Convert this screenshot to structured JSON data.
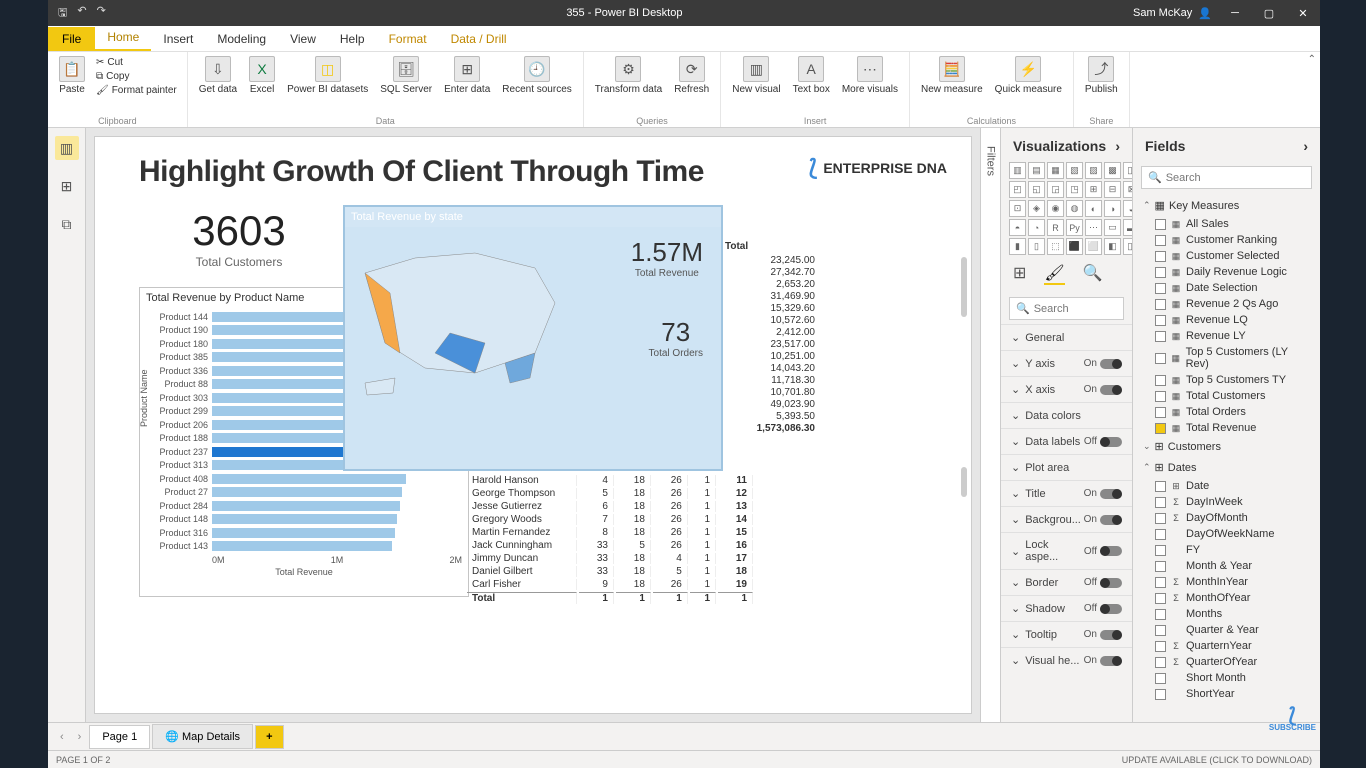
{
  "titlebar": {
    "title": "355 - Power BI Desktop",
    "user": "Sam McKay"
  },
  "ribbon_tabs": {
    "file": "File",
    "tabs": [
      "Home",
      "Insert",
      "Modeling",
      "View",
      "Help",
      "Format",
      "Data / Drill"
    ],
    "active": "Home"
  },
  "ribbon_groups": {
    "clipboard": {
      "label": "Clipboard",
      "paste": "Paste",
      "cut": "Cut",
      "copy": "Copy",
      "format_painter": "Format painter"
    },
    "data": {
      "label": "Data",
      "get_data": "Get\ndata",
      "excel": "Excel",
      "pbi_ds": "Power BI\ndatasets",
      "sql": "SQL\nServer",
      "enter": "Enter\ndata",
      "recent": "Recent\nsources"
    },
    "queries": {
      "label": "Queries",
      "transform": "Transform\ndata",
      "refresh": "Refresh"
    },
    "insert": {
      "label": "Insert",
      "new_visual": "New\nvisual",
      "text_box": "Text\nbox",
      "more": "More\nvisuals"
    },
    "calc": {
      "label": "Calculations",
      "new_measure": "New\nmeasure",
      "quick": "Quick\nmeasure"
    },
    "share": {
      "label": "Share",
      "publish": "Publish"
    }
  },
  "report": {
    "title": "Highlight Growth Of Client Through Time",
    "logo": "ENTERPRISE DNA"
  },
  "card_customers": {
    "value": "3603",
    "label": "Total Customers"
  },
  "map": {
    "title": "Total Revenue by state",
    "kpi1_value": "1.57M",
    "kpi1_label": "Total Revenue",
    "kpi2_value": "73",
    "kpi2_label": "Total Orders"
  },
  "totals_col": {
    "header": "Total",
    "values": [
      "23,245.00",
      "27,342.70",
      "2,653.20",
      "31,469.90",
      "15,329.60",
      "10,572.60",
      "2,412.00",
      "23,517.00",
      "10,251.00",
      "14,043.20",
      "11,718.30",
      "10,701.80",
      "49,023.90",
      "5,393.50"
    ],
    "grand": "1,573,086.30"
  },
  "chart_data": {
    "type": "bar",
    "title": "Total Revenue by Product Name",
    "xlabel": "Total Revenue",
    "ylabel": "Product Name",
    "xlim_labels": [
      "0M",
      "1M",
      "2M"
    ],
    "selected": "Product 237",
    "series": [
      {
        "name": "Product 144",
        "value": 1.95
      },
      {
        "name": "Product 190",
        "value": 1.9
      },
      {
        "name": "Product 180",
        "value": 1.88
      },
      {
        "name": "Product 385",
        "value": 1.82
      },
      {
        "name": "Product 336",
        "value": 1.8
      },
      {
        "name": "Product 88",
        "value": 1.78
      },
      {
        "name": "Product 303",
        "value": 1.75
      },
      {
        "name": "Product 299",
        "value": 1.72
      },
      {
        "name": "Product 206",
        "value": 1.7
      },
      {
        "name": "Product 188",
        "value": 1.68
      },
      {
        "name": "Product 237",
        "value": 1.67
      },
      {
        "name": "Product 313",
        "value": 1.6
      },
      {
        "name": "Product 408",
        "value": 1.55
      },
      {
        "name": "Product 27",
        "value": 1.52
      },
      {
        "name": "Product 284",
        "value": 1.5
      },
      {
        "name": "Product 148",
        "value": 1.48
      },
      {
        "name": "Product 316",
        "value": 1.46
      },
      {
        "name": "Product 143",
        "value": 1.44
      }
    ]
  },
  "table": {
    "rows": [
      {
        "name": "Harold Hanson",
        "c1": "4",
        "c2": "18",
        "c3": "26",
        "c4": "1",
        "c5": "11"
      },
      {
        "name": "George Thompson",
        "c1": "5",
        "c2": "18",
        "c3": "26",
        "c4": "1",
        "c5": "12"
      },
      {
        "name": "Jesse Gutierrez",
        "c1": "6",
        "c2": "18",
        "c3": "26",
        "c4": "1",
        "c5": "13"
      },
      {
        "name": "Gregory Woods",
        "c1": "7",
        "c2": "18",
        "c3": "26",
        "c4": "1",
        "c5": "14"
      },
      {
        "name": "Martin Fernandez",
        "c1": "8",
        "c2": "18",
        "c3": "26",
        "c4": "1",
        "c5": "15"
      },
      {
        "name": "Jack Cunningham",
        "c1": "33",
        "c2": "5",
        "c3": "26",
        "c4": "1",
        "c5": "16"
      },
      {
        "name": "Jimmy Duncan",
        "c1": "33",
        "c2": "18",
        "c3": "4",
        "c4": "1",
        "c5": "17"
      },
      {
        "name": "Daniel Gilbert",
        "c1": "33",
        "c2": "18",
        "c3": "5",
        "c4": "1",
        "c5": "18"
      },
      {
        "name": "Carl Fisher",
        "c1": "9",
        "c2": "18",
        "c3": "26",
        "c4": "1",
        "c5": "19"
      }
    ],
    "total_label": "Total",
    "total": {
      "c1": "1",
      "c2": "1",
      "c3": "1",
      "c4": "1",
      "c5": "1"
    }
  },
  "filters_label": "Filters",
  "viz_pane": {
    "title": "Visualizations",
    "search": "Search",
    "sections": [
      {
        "name": "General",
        "toggle": null
      },
      {
        "name": "Y axis",
        "toggle": "On"
      },
      {
        "name": "X axis",
        "toggle": "On"
      },
      {
        "name": "Data colors",
        "toggle": null
      },
      {
        "name": "Data labels",
        "toggle": "Off"
      },
      {
        "name": "Plot area",
        "toggle": null
      },
      {
        "name": "Title",
        "toggle": "On"
      },
      {
        "name": "Backgrou...",
        "toggle": "On"
      },
      {
        "name": "Lock aspe...",
        "toggle": "Off"
      },
      {
        "name": "Border",
        "toggle": "Off"
      },
      {
        "name": "Shadow",
        "toggle": "Off"
      },
      {
        "name": "Tooltip",
        "toggle": "On"
      },
      {
        "name": "Visual he...",
        "toggle": "On"
      }
    ]
  },
  "fields_pane": {
    "title": "Fields",
    "search": "Search",
    "groups": [
      {
        "name": "Key Measures",
        "icon": "▦",
        "expanded": true,
        "items": [
          {
            "name": "All Sales",
            "icon": "▦",
            "checked": false
          },
          {
            "name": "Customer Ranking",
            "icon": "▦",
            "checked": false
          },
          {
            "name": "Customer Selected",
            "icon": "▦",
            "checked": false
          },
          {
            "name": "Daily Revenue Logic",
            "icon": "▦",
            "checked": false
          },
          {
            "name": "Date Selection",
            "icon": "▦",
            "checked": false
          },
          {
            "name": "Revenue 2 Qs Ago",
            "icon": "▦",
            "checked": false
          },
          {
            "name": "Revenue LQ",
            "icon": "▦",
            "checked": false
          },
          {
            "name": "Revenue LY",
            "icon": "▦",
            "checked": false
          },
          {
            "name": "Top 5 Customers (LY Rev)",
            "icon": "▦",
            "checked": false
          },
          {
            "name": "Top 5 Customers TY",
            "icon": "▦",
            "checked": false
          },
          {
            "name": "Total Customers",
            "icon": "▦",
            "checked": false
          },
          {
            "name": "Total Orders",
            "icon": "▦",
            "checked": false
          },
          {
            "name": "Total Revenue",
            "icon": "▦",
            "checked": true
          }
        ]
      },
      {
        "name": "Customers",
        "icon": "⊞",
        "expanded": false,
        "items": []
      },
      {
        "name": "Dates",
        "icon": "⊞",
        "expanded": true,
        "items": [
          {
            "name": "Date",
            "icon": "⊞",
            "checked": false,
            "caret": true
          },
          {
            "name": "DayInWeek",
            "icon": "Σ",
            "checked": false
          },
          {
            "name": "DayOfMonth",
            "icon": "Σ",
            "checked": false
          },
          {
            "name": "DayOfWeekName",
            "icon": "",
            "checked": false
          },
          {
            "name": "FY",
            "icon": "",
            "checked": false
          },
          {
            "name": "Month & Year",
            "icon": "",
            "checked": false
          },
          {
            "name": "MonthInYear",
            "icon": "Σ",
            "checked": false
          },
          {
            "name": "MonthOfYear",
            "icon": "Σ",
            "checked": false
          },
          {
            "name": "Months",
            "icon": "",
            "checked": false
          },
          {
            "name": "Quarter & Year",
            "icon": "",
            "checked": false
          },
          {
            "name": "QuarternYear",
            "icon": "Σ",
            "checked": false
          },
          {
            "name": "QuarterOfYear",
            "icon": "Σ",
            "checked": false
          },
          {
            "name": "Short Month",
            "icon": "",
            "checked": false
          },
          {
            "name": "ShortYear",
            "icon": "",
            "checked": false
          }
        ]
      }
    ]
  },
  "page_tabs": {
    "tabs": [
      "Page 1",
      "Map Details"
    ],
    "active": "Page 1",
    "add": "+"
  },
  "status": {
    "left": "PAGE 1 OF 2",
    "right": "UPDATE AVAILABLE (CLICK TO DOWNLOAD)"
  },
  "subscribe": "SUBSCRIBE"
}
